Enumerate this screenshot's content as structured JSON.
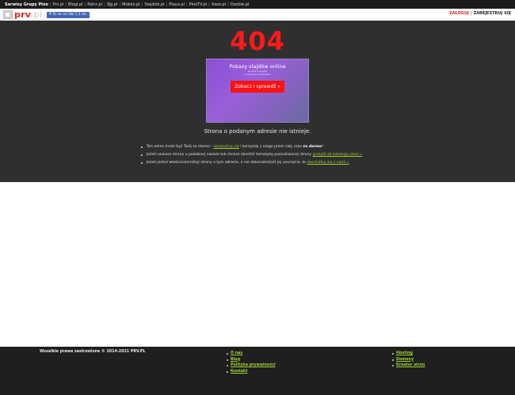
{
  "topbar": {
    "label": "Serwisy Grupy Pino",
    "links": [
      "Prv.pl",
      "Blogi.pl",
      "Patrz.pl",
      "3jg.pl",
      "Mobiio.pl",
      "Slajdzik.pl",
      "Playa.pl",
      "PinoTV.pl",
      "Xoxo.pl",
      "Osobie.pl"
    ]
  },
  "header": {
    "logo_main": "prv",
    "logo_tld": ".pl",
    "fb_label": "To se mi líbí",
    "fb_count": "1,1 tis.",
    "login": "ZALOGUJ",
    "auth_separator": "|",
    "register": "ZAREJESTRUJ SIĘ"
  },
  "error": {
    "code": "404",
    "message": "Strona o podanym adresie nie istnieje."
  },
  "ad": {
    "title": "Pokazy slajdów online",
    "line1": "ze zdjęć, z muzyką",
    "line2": "na telefonie i komputerze",
    "cta": "Zobacz i sprawdź »"
  },
  "tips": {
    "t1_pre": "Ten adres może być Twój za darmo - ",
    "t1_link": "zarejestruj się",
    "t1_mid": " i korzystaj z niego przez cały czas ",
    "t1_bold": "za darmo",
    "t1_post": "!",
    "t2_pre": "Jeżeli szukasz strony o podobnej nazwie lub chcesz określić tematykę poszukiwanej strony ",
    "t2_link": "przejdź do katalogu stron »",
    "t3_pre": "Jeżeli jesteś właścicielem(ką) strony o tym adresie, a nie dokonałeś(aś) jej usunięcia, to ",
    "t3_link": "skontaktuj się z nami »"
  },
  "footer": {
    "copyright": "Wszelkie prawa zastrzeżone © 2014-2021 PRV.PL",
    "col1": [
      "O nas",
      "Blog",
      "Polityka prywatności",
      "Kontakt"
    ],
    "col2": [
      "Hosting",
      "Domeny",
      "Kreator stron"
    ]
  },
  "colors": {
    "accent_red": "#ff1a1a",
    "link_green": "#9fd12f",
    "dark_bg": "#2f2f2f",
    "footer_bg": "#1f1f1f"
  }
}
